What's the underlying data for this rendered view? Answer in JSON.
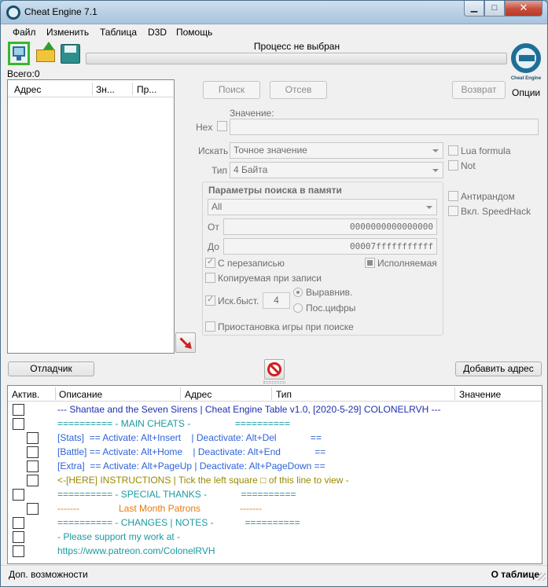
{
  "window": {
    "title": "Cheat Engine 7.1",
    "close_glyph": "✕",
    "min_glyph": "▁",
    "max_glyph": "□"
  },
  "menu": [
    "Файл",
    "Изменить",
    "Таблица",
    "D3D",
    "Помощь"
  ],
  "toolbar": {
    "buttons": [
      "open-process-icon",
      "open-file-icon",
      "save-file-icon"
    ],
    "process_title": "Процесс не выбран",
    "total_label": "Всего:",
    "total_value": "0",
    "logo_brand": "Cheat Engine",
    "options_label": "Опции"
  },
  "address_list": {
    "columns": [
      "Адрес",
      "Зн...",
      "Пр..."
    ]
  },
  "scan": {
    "first_scan": "Поиск",
    "next_scan": "Отсев",
    "undo_scan": "Возврат",
    "value_label": "Значение:",
    "hex_label": "Hex",
    "scan_type_label": "Искать",
    "scan_type_value": "Точное значение",
    "value_type_label": "Тип",
    "value_type_value": "4 Байта",
    "lua_formula": "Lua formula",
    "not": "Not",
    "antirandom": "Антирандом",
    "speedhack": "Вкл. SpeedHack"
  },
  "memory_options": {
    "title": "Параметры поиска в памяти",
    "region_value": "All",
    "from_label": "От",
    "from_value": "0000000000000000",
    "to_label": "До",
    "to_value": "00007fffffffffff",
    "writable": "С перезаписью",
    "executable": "Исполняемая",
    "copy_on_write": "Копируемая при записи",
    "fast_scan": "Иск.быст.",
    "fast_scan_value": "4",
    "alignment": "Выравнив.",
    "last_digits": "Пос.цифры",
    "pause_game": "Приостановка игры при поиске"
  },
  "buttons": {
    "debugger": "Отладчик",
    "add_address": "Добавить адрес"
  },
  "cheat_table": {
    "columns": [
      "Актив.",
      "Описание",
      "Адрес",
      "Тип",
      "Значение"
    ],
    "rows": [
      {
        "indent": 0,
        "color": "#1f2fb0",
        "text": "--- Shantae and the Seven Sirens | Cheat Engine Table v1.0, [2020-5-29] COLONELRVH ---"
      },
      {
        "indent": 0,
        "color": "#1a9aa0",
        "text": "========== - MAIN CHEATS -                 =========="
      },
      {
        "indent": 1,
        "color": "#2f63d8",
        "text": "[Stats]  == Activate: Alt+Insert    | Deactivate: Alt+Del             =="
      },
      {
        "indent": 1,
        "color": "#2f63d8",
        "text": "[Battle] == Activate: Alt+Home    | Deactivate: Alt+End             =="
      },
      {
        "indent": 1,
        "color": "#2f63d8",
        "text": "[Extra]  == Activate: Alt+PageUp | Deactivate: Alt+PageDown =="
      },
      {
        "indent": 1,
        "color": "#9a8a00",
        "text": "<-[HERE] INSTRUCTIONS | Tick the left square □ of this line to view -"
      },
      {
        "indent": 0,
        "color": "#1a9aa0",
        "text": "========== - SPECIAL THANKS -             =========="
      },
      {
        "indent": 1,
        "color": "#e87a10",
        "text": "-------               Last Month Patrons               -------"
      },
      {
        "indent": 0,
        "color": "#1a9aa0",
        "text": "========== - CHANGES | NOTES -            =========="
      },
      {
        "indent": 0,
        "color": "#1a9aa0",
        "text": "- Please support my work at -"
      },
      {
        "indent": 0,
        "color": "#1a9aa0",
        "text": "https://www.patreon.com/ColonelRVH"
      }
    ]
  },
  "status": {
    "left": "Доп. возможности",
    "right": "О таблице"
  }
}
